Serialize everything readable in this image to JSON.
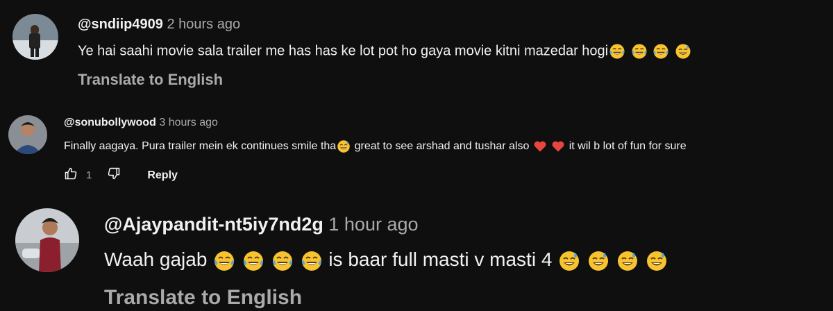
{
  "comments": [
    {
      "author": "@sndiip4909",
      "time": "2 hours ago",
      "text": "Ye hai saahi movie sala trailer me has has ke lot pot ho gaya movie kitni mazedar hogi",
      "emojis": [
        "laughing-tears",
        "laughing-tears",
        "laughing-tears",
        "grin-sweat"
      ],
      "translate_label": "Translate to English"
    },
    {
      "author": "@sonubollywood",
      "time": "3 hours ago",
      "text_1": "Finally aagaya. Pura trailer mein ek continues smile tha",
      "text_2": "great to see arshad and tushar also",
      "text_3": "it wil b lot of fun for sure",
      "like_count": "1",
      "reply_label": "Reply"
    },
    {
      "author": "@Ajaypandit-nt5iy7nd2g",
      "time": "1 hour ago",
      "text_1": "Waah gajab",
      "text_2": "is baar full masti v masti 4",
      "translate_label": "Translate to English"
    }
  ],
  "colors": {
    "background": "#0f0f0f",
    "primary_text": "#f1f1f1",
    "secondary_text": "#aaaaaa",
    "emoji_face": "#f7c330",
    "heart": "#e8453c",
    "tear": "#4aa8e8"
  }
}
